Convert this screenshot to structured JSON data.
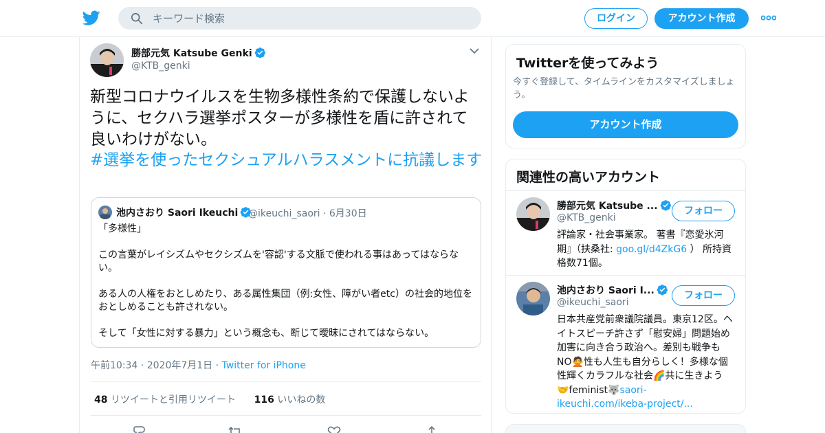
{
  "header": {
    "search_placeholder": "キーワード検索",
    "login_label": "ログイン",
    "signup_label": "アカウント作成",
    "brand_color": "#1da1f2"
  },
  "tweet": {
    "author_name": "勝部元気 Katsube Genki",
    "author_handle": "@KTB_genki",
    "text": "新型コロナウイルスを生物多様性条約で保護しないように、セクハラ選挙ポスターが多様性を盾に許されて良いわけがない。",
    "hashtag": "#選挙を使ったセクシュアルハラスメントに抗議します",
    "time": "午前10:34",
    "date": "2020年7月1日",
    "source": "Twitter for iPhone",
    "retweets_count": "48",
    "retweets_label": "リツイートと引用リツイート",
    "likes_count": "116",
    "likes_label": "いいねの数"
  },
  "quote": {
    "author_name": "池内さおり Saori Ikeuchi",
    "author_handle": "@ikeuchi_saori",
    "date": "6月30日",
    "paragraphs": [
      "「多様性」",
      "この言葉がレイシズムやセクシズムを'容認'する文脈で使われる事はあってはならない。",
      "ある人の人権をおとしめたり、ある属性集団（例:女性、障がい者etc）の社会的地位をおとしめることも許されない。",
      "そして「女性に対する暴力」という概念も、断じて曖昧にされてはならない。"
    ]
  },
  "signup_card": {
    "title": "Twitterを使ってみよう",
    "subtitle": "今すぐ登録して、タイムラインをカスタマイズしましょう。",
    "button_label": "アカウント作成"
  },
  "related": {
    "title": "関連性の高いアカウント",
    "follow_label": "フォロー",
    "accounts": [
      {
        "name": "勝部元気 Katsube ...",
        "handle": "@KTB_genki",
        "bio_prefix": "評論家・社会事業家。 著書『恋愛氷河期』（扶桑社: ",
        "bio_link": "goo.gl/d4ZkG6",
        "bio_suffix": " ） 所持資格数71個。"
      },
      {
        "name": "池内さおり Saori I...",
        "handle": "@ikeuchi_saori",
        "bio_prefix": "日本共産党前衆議院議員。東京12区。ヘイトスピーチ許さず「慰安婦」問題始め加害に向き合う政治へ。差別も戦争もNO🙅性も人生も自分らしく！多様な個性輝くカラフルな社会🌈共に生きよう🤝feminist🐺",
        "bio_link": "saori-ikeuchi.com/ikeba-project/...",
        "bio_suffix": ""
      }
    ]
  }
}
